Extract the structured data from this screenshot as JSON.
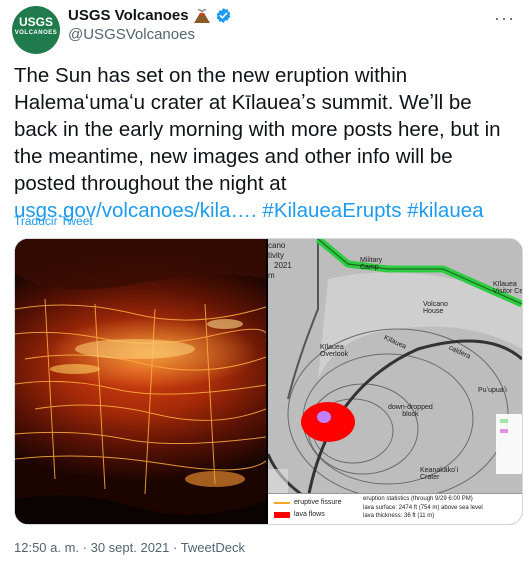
{
  "account": {
    "display_name": "USGS Volcanoes",
    "handle": "@USGSVolcanoes",
    "avatar_text": "USGS",
    "avatar_subtext": "VOLCANOES"
  },
  "tweet": {
    "text_main": "The Sun has set on the new eruption within Halemaʻumaʻu crater at Kīlaueaʼs summit. Weʼll be back in the early morning with more posts here, but in the meantime, new images and other info will be posted throughout the night at ",
    "link": "usgs.gov/volcanoes/kila….",
    "hashtag1": "#KilaueaErupts",
    "hashtag2": "#kilauea",
    "translate_label": "Traducir Tweet",
    "timestamp": "12:50 a. m. · 30 sept. 2021 · TweetDeck"
  },
  "map": {
    "labels": {
      "title1": "cano",
      "title2": "tivity",
      "title3": "2021",
      "title4": "m",
      "camp": "Military\nCamp",
      "kilauea": "Kīlauea",
      "visitor": "Kīlauea\nVisitor Ce",
      "volcano_house": "Volcano\nHouse",
      "overlook": "Kīlauea\nOverlook",
      "caldera": "caldera",
      "downdropped": "down-dropped\nblock",
      "puuipuai": "Puʻupuaʻi",
      "keanakakoi": "Keanakākoʻi\nCrater",
      "fissure": "eruptive fissure",
      "lava": "lava flows",
      "stats1": "eruption statistics (through 9/29 6:00 PM)",
      "stats2": "lava surface: 2474 ft (754 m) above sea level",
      "stats3": "lava thickness: 36 ft (11 m)"
    }
  },
  "colors": {
    "link": "#1d9bf0",
    "avatar_bg": "#1f7a4c",
    "verified": "#1d9bf0",
    "lava": "#ff0000",
    "road": "#2ecc40"
  }
}
